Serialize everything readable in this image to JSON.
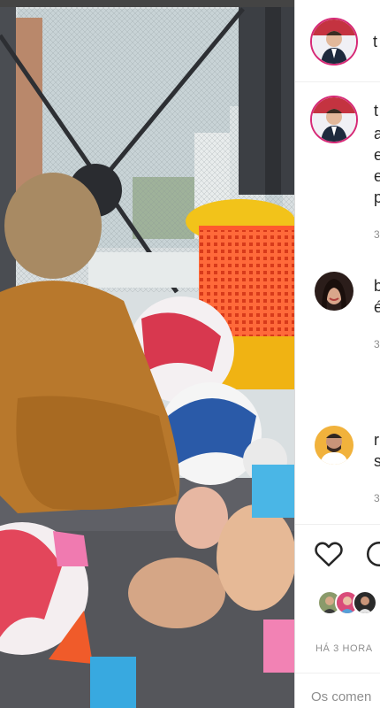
{
  "post": {
    "photo_alt": "Child playing with balls and toys by a window"
  },
  "header": {
    "username_fragment": "t"
  },
  "comments": [
    {
      "initial_lines": [
        "t",
        "a",
        "e",
        "e",
        "p"
      ],
      "time_fragment": "3"
    },
    {
      "initial_lines": [
        "b",
        "é"
      ],
      "time_fragment": "3"
    },
    {
      "initial_lines": [
        "r",
        "s"
      ],
      "time_fragment": "3"
    }
  ],
  "actions": {
    "date_label": "HÁ 3 HORA",
    "comment_placeholder": "Os comen"
  },
  "colors": {
    "accent_ring": "#d62976",
    "text": "#262626",
    "muted": "#8e8e8e"
  }
}
